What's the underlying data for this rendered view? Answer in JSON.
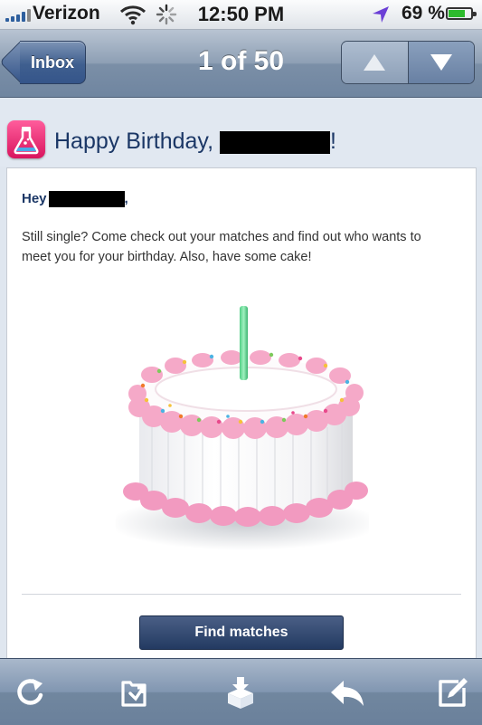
{
  "status_bar": {
    "carrier": "Verizon",
    "time": "12:50 PM",
    "battery_percent": "69 %",
    "battery_level": 0.69,
    "icons": [
      "signal-icon",
      "wifi-icon",
      "activity-spinner-icon",
      "location-arrow-icon",
      "battery-icon"
    ]
  },
  "nav": {
    "back_label": "Inbox",
    "title": "1 of 50",
    "icons": [
      "up-arrow-icon",
      "down-arrow-icon"
    ]
  },
  "subject": {
    "prefix": "Happy Birthday, ",
    "suffix": "!"
  },
  "message": {
    "greeting_prefix": "Hey",
    "greeting_suffix": ",",
    "body": "Still single? Come check out your matches and find out who wants to meet you for your birthday. Also, have some cake!",
    "button_label": "Find matches"
  },
  "toolbar": {
    "icons": [
      "refresh-icon",
      "move-to-folder-icon",
      "archive-icon",
      "reply-icon",
      "compose-icon"
    ]
  },
  "colors": {
    "subject_text": "#1b3766",
    "nav_bar": "#7b8fa7",
    "button": "#2e4470",
    "app_icon": "#e8307a"
  }
}
